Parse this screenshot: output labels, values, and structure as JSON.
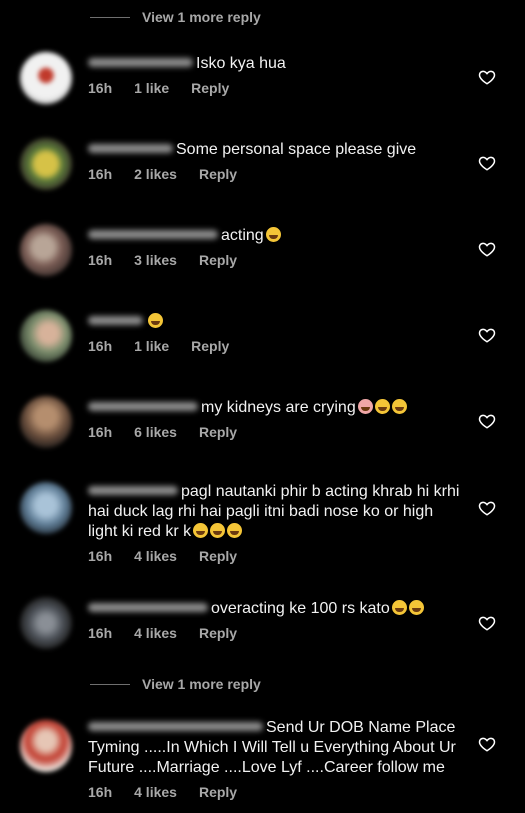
{
  "replies_toggle_top": {
    "label": "View 1 more reply"
  },
  "replies_toggle_bottom": {
    "label": "View 1 more reply"
  },
  "icons": {
    "like": "heart-outline-icon",
    "emoji": "laughing-emoji"
  },
  "colors": {
    "background": "#000000",
    "text": "#f2f2f2",
    "muted": "#a8a8a8"
  },
  "comments": [
    {
      "text": "Isko kya hua",
      "time": "16h",
      "likes": "1 like",
      "reply": "Reply"
    },
    {
      "text": "Some personal space please give",
      "time": "16h",
      "likes": "2 likes",
      "reply": "Reply"
    },
    {
      "text": "acting",
      "time": "16h",
      "likes": "3 likes",
      "reply": "Reply"
    },
    {
      "text": "",
      "time": "16h",
      "likes": "1 like",
      "reply": "Reply"
    },
    {
      "text": "my kidneys are crying",
      "time": "16h",
      "likes": "6 likes",
      "reply": "Reply"
    },
    {
      "text": "pagl nautanki phir b acting khrab hi krhi hai duck lag rhi hai pagli itni badi nose ko or high light ki red kr k",
      "time": "16h",
      "likes": "4 likes",
      "reply": "Reply"
    },
    {
      "text": "overacting ke 100 rs kato",
      "time": "16h",
      "likes": "4 likes",
      "reply": "Reply"
    },
    {
      "text": "Send Ur  DOB Name  Place Tyming .....In Which I Will Tell u Everything About Ur Future ....Marriage ....Love Lyf ....Career follow me",
      "time": "16h",
      "likes": "4 likes",
      "reply": "Reply"
    }
  ]
}
